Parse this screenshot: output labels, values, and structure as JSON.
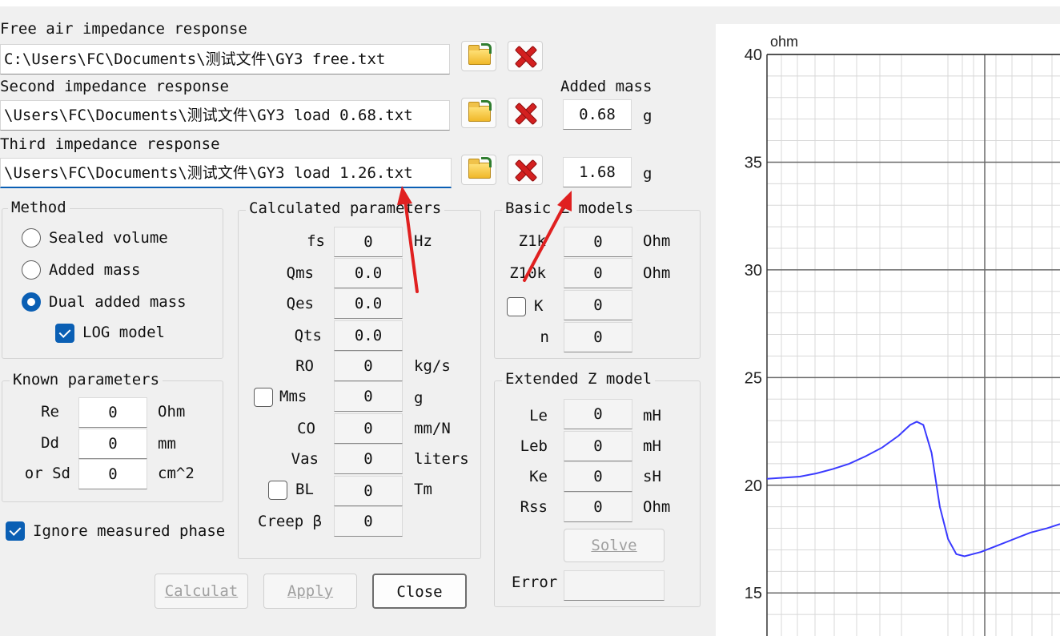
{
  "files": {
    "free_label": "Free air impedance response",
    "free_path": "C:\\Users\\FC\\Documents\\测试文件\\GY3 free.txt",
    "second_label": "Second impedance response",
    "second_path": "\\Users\\FC\\Documents\\测试文件\\GY3 load 0.68.txt",
    "third_label": "Third impedance response",
    "third_path": "\\Users\\FC\\Documents\\测试文件\\GY3 load 1.26.txt",
    "added_mass_label": "Added mass",
    "mass1": "0.68",
    "mass2": "1.68",
    "mass_unit": "g"
  },
  "method": {
    "title": "Method",
    "sealed_volume": "Sealed volume",
    "added_mass": "Added mass",
    "dual_added_mass": "Dual added mass",
    "log_model": "LOG model",
    "selected": "dual_added_mass",
    "log_model_checked": true
  },
  "known": {
    "title": "Known parameters",
    "rows": [
      {
        "label": "Re",
        "value": "0",
        "unit": "Ohm"
      },
      {
        "label": "Dd",
        "value": "0",
        "unit": "mm"
      },
      {
        "label": "or Sd",
        "value": "0",
        "unit": "cm^2"
      }
    ]
  },
  "ignore_phase": {
    "label": "Ignore measured phase",
    "checked": true
  },
  "calc": {
    "title": "Calculated parameters",
    "rows": [
      {
        "label": "fs",
        "value": "0",
        "unit": "Hz"
      },
      {
        "label": "Qms",
        "value": "0.0",
        "unit": ""
      },
      {
        "label": "Qes",
        "value": "0.0",
        "unit": ""
      },
      {
        "label": "Qts",
        "value": "0.0",
        "unit": ""
      },
      {
        "label": "RO",
        "value": "0",
        "unit": "kg/s"
      },
      {
        "label": "Mms",
        "value": "0",
        "unit": "g"
      },
      {
        "label": "CO",
        "value": "0",
        "unit": "mm/N"
      },
      {
        "label": "Vas",
        "value": "0",
        "unit": "liters"
      },
      {
        "label": "BL",
        "value": "0",
        "unit": "Tm"
      },
      {
        "label": "Creep β",
        "value": "0",
        "unit": ""
      }
    ]
  },
  "basic": {
    "title": "Basic Z models",
    "rows": [
      {
        "label": "Z1k",
        "value": "0",
        "unit": "Ohm"
      },
      {
        "label": "Z10k",
        "value": "0",
        "unit": "Ohm"
      },
      {
        "label": "K",
        "value": "0",
        "unit": ""
      },
      {
        "label": "n",
        "value": "0",
        "unit": ""
      }
    ]
  },
  "extended": {
    "title": "Extended Z model",
    "rows": [
      {
        "label": "Le",
        "value": "0",
        "unit": "mH"
      },
      {
        "label": "Leb",
        "value": "0",
        "unit": "mH"
      },
      {
        "label": "Ke",
        "value": "0",
        "unit": "sH"
      },
      {
        "label": "Rss",
        "value": "0",
        "unit": "Ohm"
      }
    ],
    "solve": "Solve",
    "error_label": "Error",
    "error_value": ""
  },
  "buttons": {
    "calculate": "Calculat",
    "apply": "Apply",
    "close": "Close"
  },
  "chart_data": {
    "type": "line",
    "ylabel": "ohm",
    "ylim": [
      13,
      40
    ],
    "yticks": [
      15,
      20,
      25,
      30,
      35,
      40
    ],
    "grid": true,
    "line_color": "#3a3aff",
    "series": [
      {
        "x": [
          0,
          0.1,
          0.2,
          0.3,
          0.4,
          0.5,
          0.6,
          0.7,
          0.8,
          0.87,
          0.91,
          0.95,
          1.0,
          1.05,
          1.1,
          1.15,
          1.2,
          1.3,
          1.4,
          1.5,
          1.6,
          1.7,
          1.78
        ],
        "values": [
          20.3,
          20.35,
          20.4,
          20.55,
          20.75,
          21.0,
          21.35,
          21.75,
          22.3,
          22.8,
          22.95,
          22.8,
          21.5,
          19.0,
          17.5,
          16.8,
          16.7,
          16.9,
          17.2,
          17.5,
          17.8,
          18.0,
          18.2
        ]
      }
    ]
  }
}
